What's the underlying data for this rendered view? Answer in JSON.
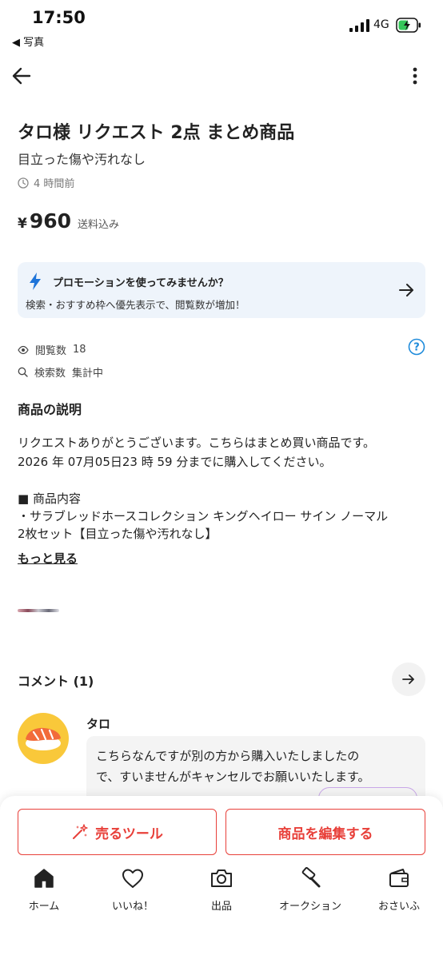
{
  "status_bar": {
    "time": "17:50",
    "back_app": "◀ 写真",
    "network": "4G"
  },
  "product": {
    "title": "タロ様 リクエスト 2点 まとめ商品",
    "condition": "目立った傷や汚れなし",
    "posted": "4 時間前",
    "currency": "¥",
    "price": "960",
    "shipping": "送料込み"
  },
  "promo": {
    "title": "プロモーションを使ってみませんか？",
    "subtitle": "検索・おすすめ枠へ優先表示で、閲覧数が増加！"
  },
  "stats": {
    "views_label": "閲覧数",
    "views_value": "18",
    "search_label": "検索数",
    "search_value": "集計中"
  },
  "description": {
    "heading": "商品の説明",
    "lines": [
      "リクエストありがとうございます。こちらはまとめ買い商品です。",
      "2026 年 07月05日23 時 59 分までに購入してください。",
      "■ 商品内容",
      "・サラブレッドホースコレクション キングヘイロー サイン ノーマル",
      "2枚セット【目立った傷や汚れなし】"
    ],
    "more": "もっと見る"
  },
  "comments": {
    "heading": "コメント (1)",
    "items": [
      {
        "user": "タロ",
        "lines": [
          "こちらなんですが別の方から購入いたしましたの",
          "で、すいませんがキャンセルでお願いいたします。"
        ]
      }
    ]
  },
  "actions": {
    "sell_tools": "売るツール",
    "edit": "商品を編集する"
  },
  "tabs": [
    {
      "label": "ホーム",
      "icon": "home-icon"
    },
    {
      "label": "いいね！",
      "icon": "heart-icon"
    },
    {
      "label": "出品",
      "icon": "camera-icon"
    },
    {
      "label": "オークション",
      "icon": "gavel-icon"
    },
    {
      "label": "おさいふ",
      "icon": "wallet-icon"
    }
  ],
  "colors": {
    "accent": "#e8403a",
    "promo_bg": "#eef4fb",
    "link_blue": "#1e8bdb",
    "bolt": "#1e74d9"
  }
}
